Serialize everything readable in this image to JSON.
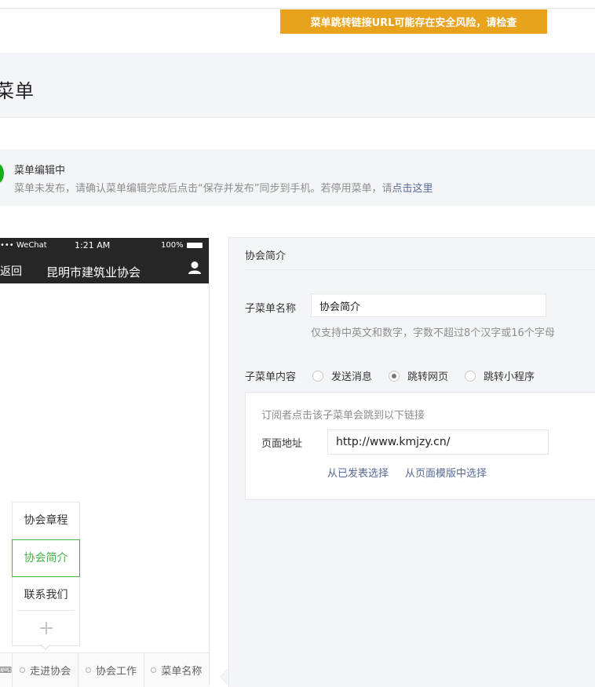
{
  "warning": "菜单跳转链接URL可能存在安全风险，请检查",
  "page_title": "菜单",
  "notice": {
    "title": "菜单编辑中",
    "desc_prefix": "菜单未发布，请确认菜单编辑完成后点击“保存并发布”同步到手机。若停用菜单，请",
    "desc_link": "点击这里"
  },
  "phone": {
    "carrier": "••• WeChat",
    "time": "1:21 AM",
    "battery": "100%",
    "back": "返回",
    "account_name": "昆明市建筑业协会",
    "submenu": [
      "协会章程",
      "协会简介",
      "联系我们"
    ],
    "submenu_active_index": 1,
    "add_symbol": "+",
    "keyboard_icon": "keyboard-icon",
    "tabs": [
      "走进协会",
      "协会工作",
      "菜单名称"
    ]
  },
  "editor": {
    "title": "协会简介",
    "name_label": "子菜单名称",
    "name_value": "协会简介",
    "name_hint": "仅支持中英文和数字，字数不超过8个汉字或16个字母",
    "content_label": "子菜单内容",
    "options": [
      "发送消息",
      "跳转网页",
      "跳转小程序"
    ],
    "selected_option": "跳转网页",
    "url_intro": "订阅者点击该子菜单会跳到以下链接",
    "url_label": "页面地址",
    "url_value": "http://www.kmjzy.cn/",
    "link_published": "从已发表选择",
    "link_template": "从页面模版中选择"
  },
  "colors": {
    "warning": "#e9a21c",
    "accent_green": "#44b549",
    "link": "#576b95"
  }
}
